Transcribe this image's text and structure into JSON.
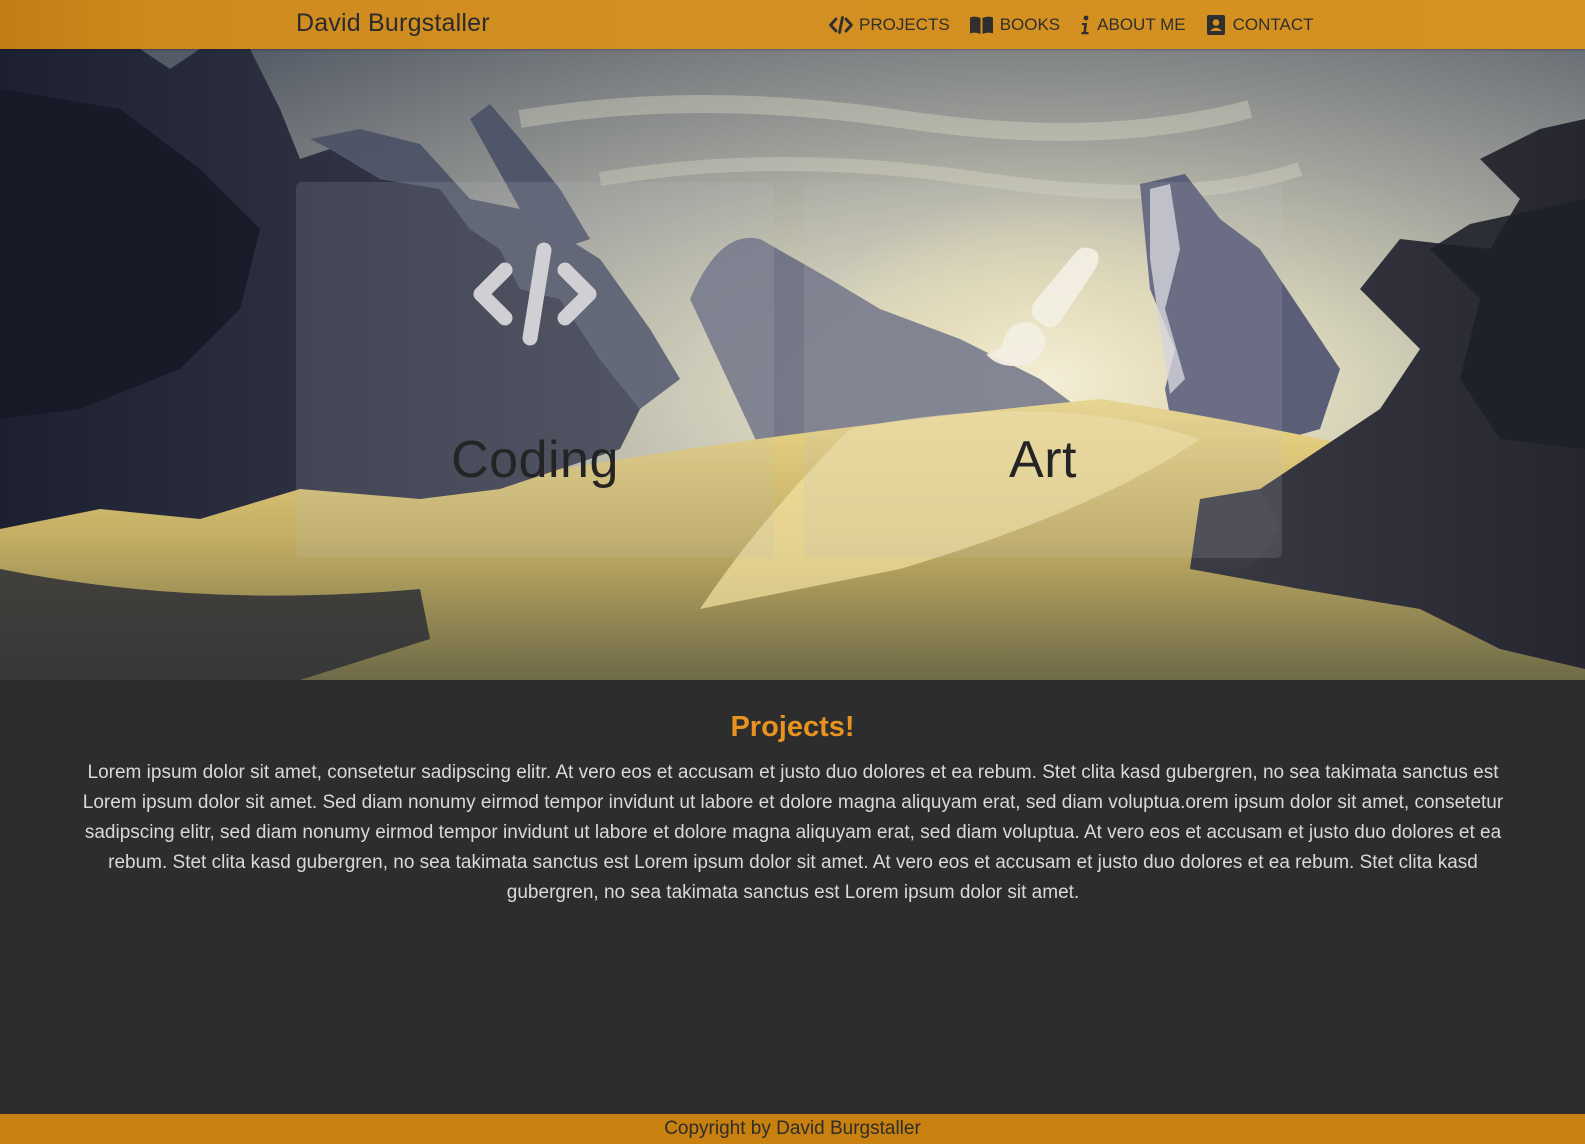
{
  "header": {
    "brand": "David Burgstaller",
    "nav": [
      {
        "label": "PROJECTS",
        "icon": "code-icon"
      },
      {
        "label": "BOOKS",
        "icon": "book-icon"
      },
      {
        "label": "ABOUT ME",
        "icon": "info-icon"
      },
      {
        "label": "CONTACT",
        "icon": "contact-card-icon"
      }
    ]
  },
  "hero": {
    "cards": [
      {
        "title": "Coding",
        "icon": "code-icon"
      },
      {
        "title": "Art",
        "icon": "paint-brush-icon"
      }
    ]
  },
  "projects": {
    "heading": "Projects!",
    "body": "Lorem ipsum dolor sit amet, consetetur sadipscing elitr. At vero eos et accusam et justo duo dolores et ea rebum. Stet clita kasd gubergren, no sea takimata sanctus est Lorem ipsum dolor sit amet. Sed diam nonumy eirmod tempor invidunt ut labore et dolore magna aliquyam erat, sed diam voluptua.orem ipsum dolor sit amet, consetetur sadipscing elitr, sed diam nonumy eirmod tempor invidunt ut labore et dolore magna aliquyam erat, sed diam voluptua. At vero eos et accusam et justo duo dolores et ea rebum. Stet clita kasd gubergren, no sea takimata sanctus est Lorem ipsum dolor sit amet. At vero eos et accusam et justo duo dolores et ea rebum. Stet clita kasd gubergren, no sea takimata sanctus est Lorem ipsum dolor sit amet."
  },
  "footer": {
    "text": "Copyright by David Burgstaller"
  },
  "colors": {
    "header_bg": "#d28f22",
    "accent_heading": "#e8931f",
    "footer_bg": "#c8800f",
    "page_bg": "#2d2d2d"
  }
}
